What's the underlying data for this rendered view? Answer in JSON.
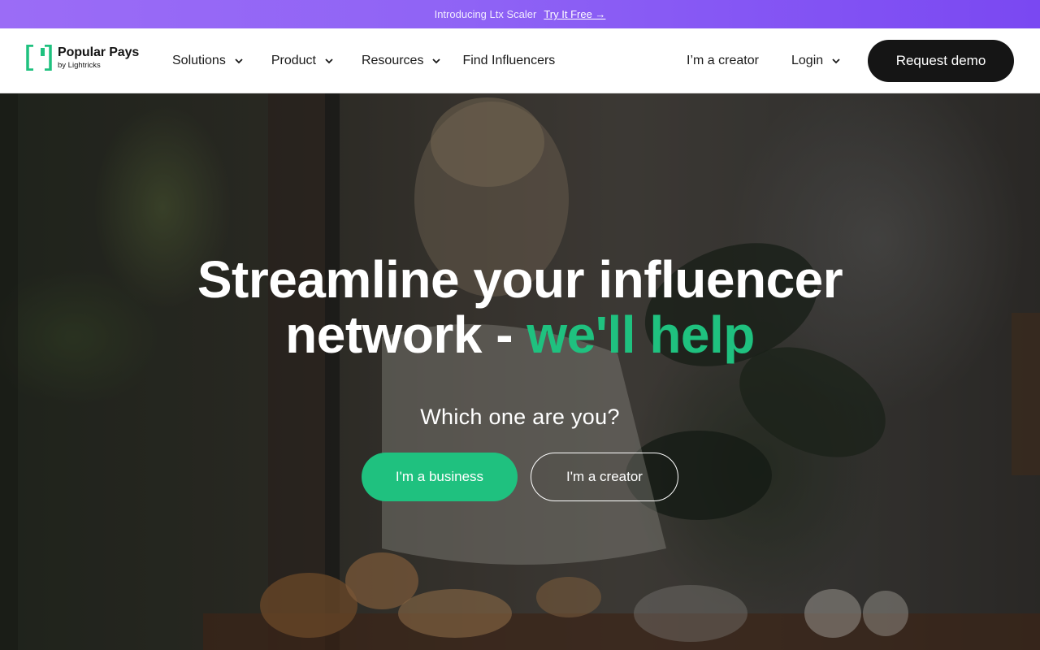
{
  "announcement": {
    "text": "Introducing Ltx Scaler",
    "link_label": "Try It Free →"
  },
  "header": {
    "logo": {
      "name": "Popular Pays",
      "sub": "by Lightricks",
      "icon": "bracket-logo-icon"
    },
    "nav": [
      {
        "label": "Solutions",
        "has_dropdown": true
      },
      {
        "label": "Product",
        "has_dropdown": true
      },
      {
        "label": "Resources",
        "has_dropdown": true
      },
      {
        "label": "Find Influencers",
        "has_dropdown": false
      }
    ],
    "creator_link": "I’m a creator",
    "login_label": "Login",
    "demo_button": "Request demo"
  },
  "hero": {
    "title_line1": "Streamline your influencer",
    "title_line2_prefix": "network - ",
    "title_line2_highlight": "we'll help",
    "question": "Which one are you?",
    "business_button": "I'm a business",
    "creator_button": "I'm a creator"
  },
  "colors": {
    "brand_green": "#1fc17f",
    "announcement_purple": "#8f63f5",
    "dark_button": "#151515"
  }
}
